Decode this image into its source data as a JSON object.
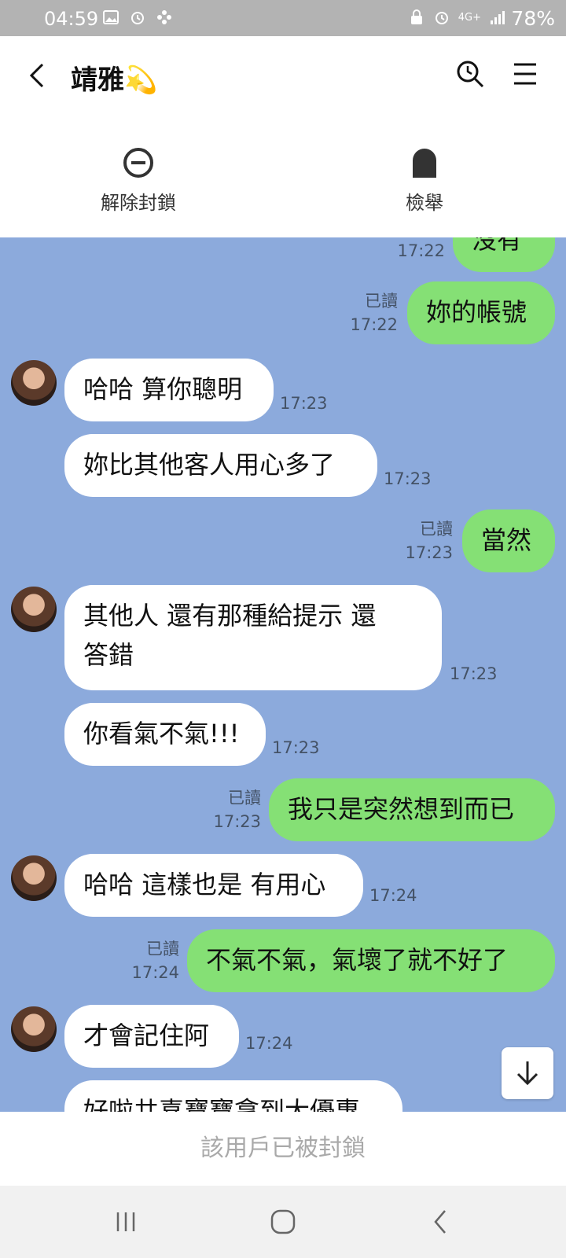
{
  "status_bar": {
    "time": "04:59",
    "network": "4G+",
    "battery": "78%"
  },
  "header": {
    "title": "靖雅💫"
  },
  "actions": {
    "unblock_label": "解除封鎖",
    "report_label": "檢舉"
  },
  "messages": [
    {
      "dir": "out",
      "text": "沒有",
      "time": "17:22"
    },
    {
      "dir": "out",
      "text": "妳的帳號",
      "read": "已讀",
      "time": "17:22"
    },
    {
      "dir": "in",
      "text": "哈哈 算你聰明",
      "time": "17:23"
    },
    {
      "dir": "in",
      "text": "妳比其他客人用心多了",
      "time": "17:23"
    },
    {
      "dir": "out",
      "text": "當然",
      "read": "已讀",
      "time": "17:23"
    },
    {
      "dir": "in",
      "text_line1": "其他人 還有那種給提示 還",
      "text_line2": "答錯",
      "time": "17:23"
    },
    {
      "dir": "in",
      "text": "你看氣不氣!!!",
      "time": "17:23"
    },
    {
      "dir": "out",
      "text": "我只是突然想到而已",
      "read": "已讀",
      "time": "17:23"
    },
    {
      "dir": "in",
      "text": "哈哈 這樣也是 有用心",
      "time": "17:24"
    },
    {
      "dir": "out",
      "text": "不氣不氣，氣壞了就不好了",
      "read": "已讀",
      "time": "17:24"
    },
    {
      "dir": "in",
      "text": "才會記住阿",
      "time": "17:24"
    },
    {
      "dir": "in",
      "text": "好啦共喜寶寶拿到大優惠"
    }
  ],
  "blocked_notice": "該用戶已被封鎖",
  "colors": {
    "chat_bg": "#8caadc",
    "outgoing_bubble": "#85e075",
    "incoming_bubble": "#ffffff",
    "status_bar": "#b3b3b3"
  }
}
